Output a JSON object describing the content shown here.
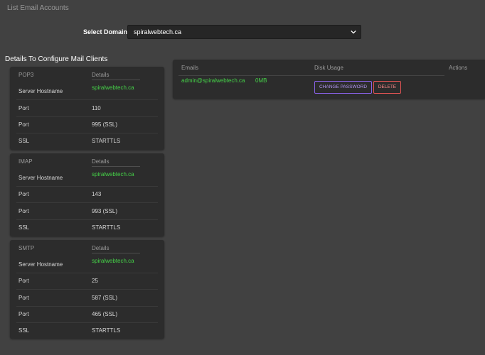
{
  "page": {
    "title": "List Email Accounts"
  },
  "domain_select": {
    "label": "Select Domain",
    "value": "spiralwebtech.ca"
  },
  "config_section": {
    "heading": "Details To Configure Mail Clients",
    "cards": [
      {
        "protocol": "POP3",
        "details_header": "Details",
        "rows": [
          {
            "key": "Server Hostname",
            "value": "spiralwebtech.ca"
          },
          {
            "key": "Port",
            "value": "110"
          },
          {
            "key": "Port",
            "value": "995 (SSL)"
          },
          {
            "key": "SSL",
            "value": "STARTTLS"
          }
        ]
      },
      {
        "protocol": "IMAP",
        "details_header": "Details",
        "rows": [
          {
            "key": "Server Hostname",
            "value": "spiralwebtech.ca"
          },
          {
            "key": "Port",
            "value": "143"
          },
          {
            "key": "Port",
            "value": "993 (SSL)"
          },
          {
            "key": "SSL",
            "value": "STARTTLS"
          }
        ]
      },
      {
        "protocol": "SMTP",
        "details_header": "Details",
        "rows": [
          {
            "key": "Server Hostname",
            "value": "spiralwebtech.ca"
          },
          {
            "key": "Port",
            "value": "25"
          },
          {
            "key": "Port",
            "value": "587 (SSL)"
          },
          {
            "key": "Port",
            "value": "465 (SSL)"
          },
          {
            "key": "SSL",
            "value": "STARTTLS"
          }
        ]
      }
    ]
  },
  "emails_table": {
    "headers": {
      "emails": "Emails",
      "disk_usage": "Disk Usage",
      "actions": "Actions"
    },
    "rows": [
      {
        "email": "admin@spiralwebtech.ca",
        "disk_usage": "0MB",
        "change_password_label": "CHANGE PASSWORD",
        "delete_label": "DELETE"
      }
    ]
  },
  "icons": {
    "select_arrow": "chevron-down-icon"
  },
  "colors": {
    "background": "#414141",
    "card": "#2c2c2c",
    "accent_green": "#45d248",
    "change_password_border": "#8a62e8",
    "delete_border": "#e55454"
  }
}
